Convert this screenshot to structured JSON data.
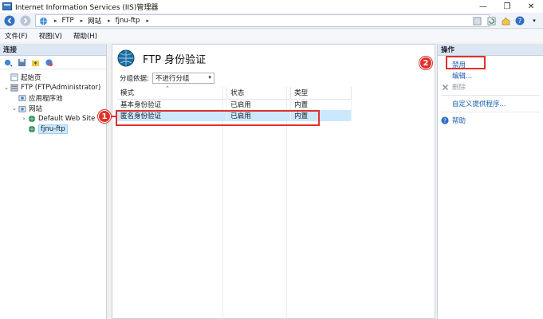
{
  "window": {
    "title": "Internet Information Services (IIS)管理器",
    "controls": [
      "—",
      "❐",
      "✕"
    ]
  },
  "address": {
    "segments": [
      "FTP",
      "网站",
      "fjnu-ftp"
    ]
  },
  "menu": [
    "文件(F)",
    "视图(V)",
    "帮助(H)"
  ],
  "left_panel": {
    "header": "连接",
    "tree": [
      {
        "label": "起始页",
        "level": 0,
        "toggle": ""
      },
      {
        "label": "FTP (FTP\\Administrator)",
        "level": 0,
        "toggle": "⌄"
      },
      {
        "label": "应用程序池",
        "level": 1,
        "toggle": ""
      },
      {
        "label": "网站",
        "level": 1,
        "toggle": "⌄"
      },
      {
        "label": "Default Web Site",
        "level": 2,
        "toggle": "›"
      },
      {
        "label": "fjnu-ftp",
        "level": 2,
        "toggle": ""
      }
    ]
  },
  "main": {
    "title": "FTP 身份验证",
    "group_by_label": "分组依据:",
    "group_by_value": "不进行分组",
    "columns": [
      "模式",
      "状态",
      "类型"
    ],
    "rows": [
      {
        "mode": "基本身份验证",
        "status": "已启用",
        "type": "内置"
      },
      {
        "mode": "匿名身份验证",
        "status": "已启用",
        "type": "内置"
      }
    ]
  },
  "right_panel": {
    "header": "操作",
    "actions": {
      "disable": "禁用",
      "edit": "编辑...",
      "remove": "删除",
      "custom_providers": "自定义提供程序...",
      "help": "帮助"
    }
  },
  "annotations": {
    "badge1": "1",
    "badge2": "2"
  },
  "colors": {
    "accent": "#e0312b",
    "link": "#1a5fb4",
    "selection": "#cce8ff"
  }
}
